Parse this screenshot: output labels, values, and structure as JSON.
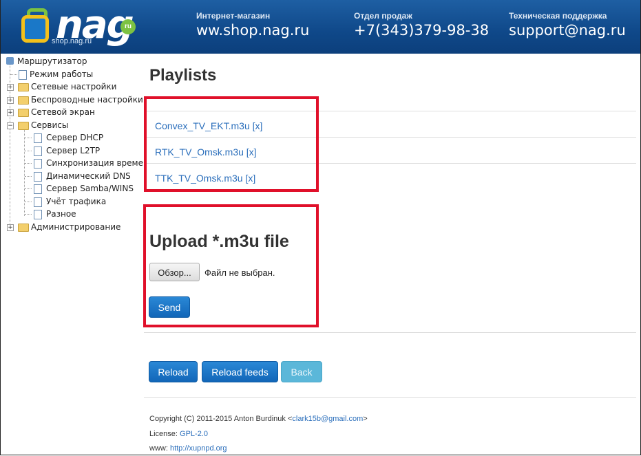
{
  "header": {
    "logo_text": "nag",
    "logo_ru": "ru",
    "logo_sub": "shop.nag.ru",
    "shop_title": "Интернет-магазин",
    "shop_value": "ww.shop.nag.ru",
    "sales_title": "Отдел продаж",
    "sales_value": "+7(343)379-98-38",
    "support_title": "Техническая поддержка",
    "support_value": "support@nag.ru",
    "bg_color": "#0f4889"
  },
  "tree": {
    "root": "Маршрутизатор",
    "items": [
      {
        "label": "Режим работы",
        "type": "doc"
      },
      {
        "label": "Сетевые настройки",
        "type": "folder"
      },
      {
        "label": "Беспроводные настройки",
        "type": "folder"
      },
      {
        "label": "Сетевой экран",
        "type": "folder"
      },
      {
        "label": "Сервисы",
        "type": "folder-open"
      },
      {
        "label": "Сервер DHCP",
        "type": "doc"
      },
      {
        "label": "Сервер L2TP",
        "type": "doc"
      },
      {
        "label": "Синхронизация времени",
        "type": "doc"
      },
      {
        "label": "Динамический DNS",
        "type": "doc"
      },
      {
        "label": "Сервер Samba/WINS",
        "type": "doc"
      },
      {
        "label": "Учёт трафика",
        "type": "doc"
      },
      {
        "label": "Разное",
        "type": "doc"
      },
      {
        "label": "Администрирование",
        "type": "folder"
      }
    ]
  },
  "main": {
    "title": "Playlists",
    "playlists": [
      {
        "name": "Convex_TV_EKT.m3u",
        "delete": "[x]"
      },
      {
        "name": "RTK_TV_Omsk.m3u",
        "delete": "[x]"
      },
      {
        "name": "TTK_TV_Omsk.m3u",
        "delete": "[x]"
      }
    ],
    "upload_title": "Upload *.m3u file",
    "browse_label": "Обзор...",
    "no_file": "Файл не выбран.",
    "send_label": "Send",
    "reload_label": "Reload",
    "reload_feeds_label": "Reload feeds",
    "back_label": "Back"
  },
  "footer": {
    "copyright_prefix": "Copyright (C) 2011-2015 Anton Burdinuk <",
    "email": "clark15b@gmail.com",
    "copyright_suffix": ">",
    "license_prefix": "License: ",
    "license": "GPL-2.0",
    "www_prefix": "www: ",
    "www": "http://xupnpd.org"
  },
  "colors": {
    "highlight": "#e0102a",
    "link": "#2a6ebb",
    "button": "#1266b8"
  }
}
